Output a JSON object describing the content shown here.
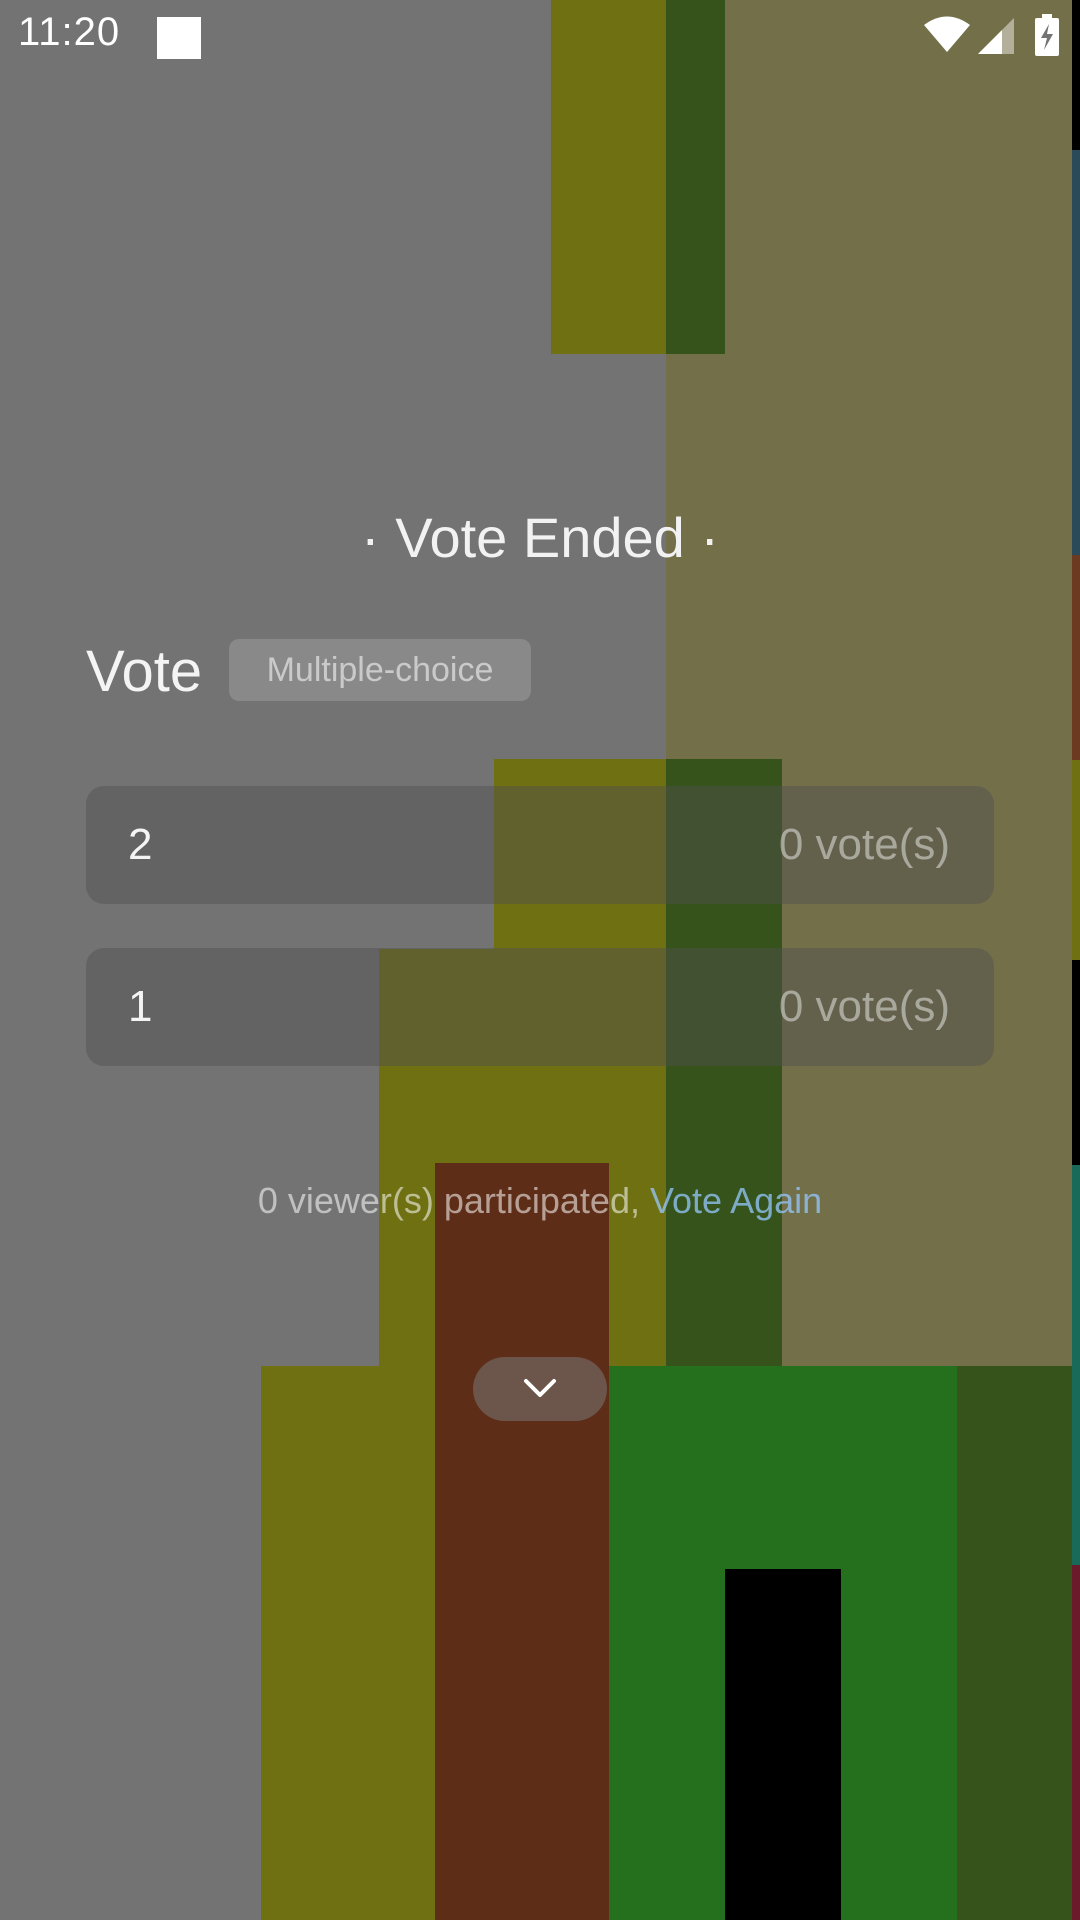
{
  "status_bar": {
    "time": "11:20"
  },
  "poll": {
    "title": "· Vote Ended ·",
    "label": "Vote",
    "type_badge": "Multiple-choice",
    "options": [
      {
        "label": "2",
        "count": "0 vote(s)"
      },
      {
        "label": "1",
        "count": "0 vote(s)"
      }
    ],
    "participation_text": "0 viewer(s) participated, ",
    "vote_again_label": "Vote Again"
  },
  "icons": {
    "wifi": "wifi-icon",
    "signal": "cellular-signal-icon",
    "battery": "battery-charging-icon",
    "collapse": "chevron-down-icon"
  },
  "colors": {
    "overlay_gray": "#737373",
    "olive": "#6f7012",
    "dark_green": "#35531a",
    "khaki": "#737049",
    "brown": "#5e2d18",
    "green": "#25701c",
    "link": "#96c8ff"
  }
}
